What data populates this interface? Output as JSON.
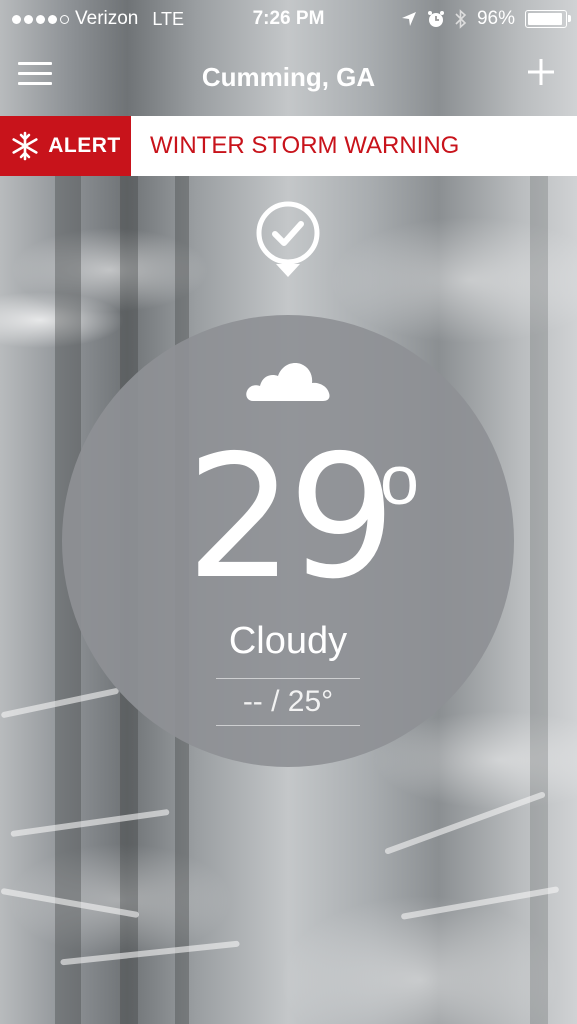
{
  "status_bar": {
    "carrier": "Verizon",
    "network": "LTE",
    "time": "7:26 PM",
    "battery": "96%",
    "signal_bars_filled": 4,
    "signal_bars_total": 5,
    "battery_level": 0.96
  },
  "nav": {
    "location": "Cumming, GA",
    "menu_icon": "hamburger-menu-icon",
    "add_icon": "plus-icon"
  },
  "alert": {
    "tag": "ALERT",
    "message": "WINTER STORM WARNING",
    "color": "#c8131b",
    "icon": "snowflake-icon"
  },
  "weather": {
    "temperature": "29",
    "degree_symbol": "o",
    "condition": "Cloudy",
    "high_low": "-- / 25°",
    "condition_icon": "cloud-icon",
    "location_icon": "location-check-icon"
  }
}
